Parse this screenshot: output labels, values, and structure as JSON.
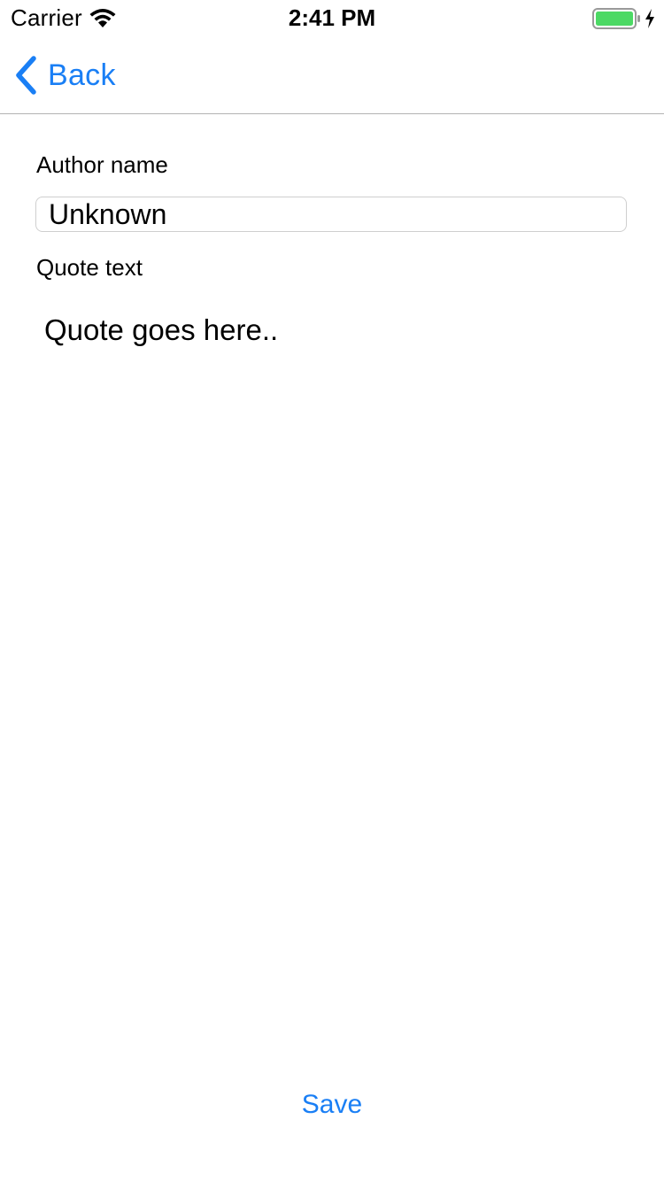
{
  "status_bar": {
    "carrier": "Carrier",
    "time": "2:41 PM",
    "icons": [
      "wifi-icon",
      "battery-icon",
      "bolt-icon"
    ],
    "battery_color": "#4cd964"
  },
  "nav_bar": {
    "back_label": "Back",
    "back_icon": "chevron-left-icon",
    "tint_color": "#1a7ff5"
  },
  "form": {
    "author_label": "Author name",
    "author_value": "Unknown",
    "quote_label": "Quote text",
    "quote_value": "Quote goes here.."
  },
  "actions": {
    "save_label": "Save"
  }
}
